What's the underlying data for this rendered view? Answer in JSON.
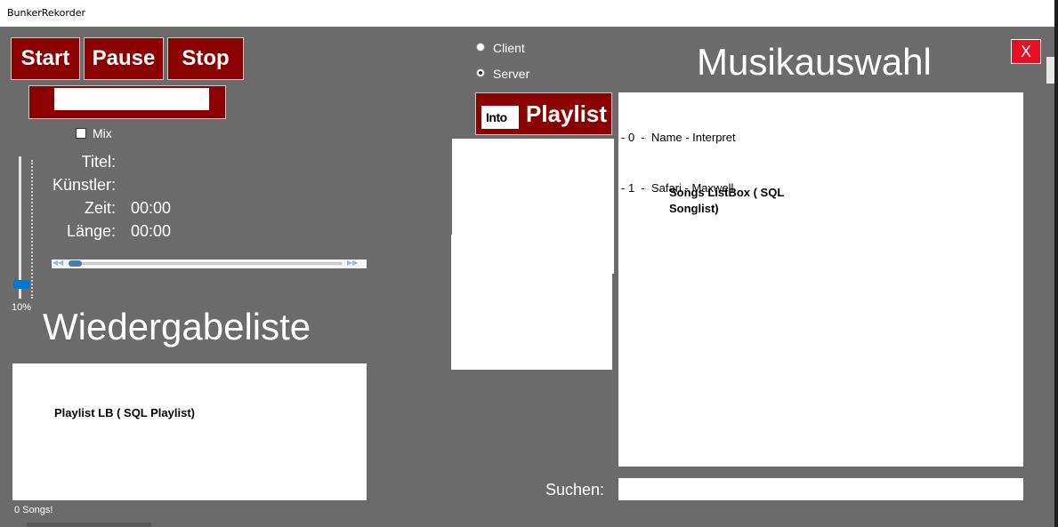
{
  "window": {
    "title": "BunkerRekorder"
  },
  "controls": {
    "start": "Start",
    "pause": "Pause",
    "stop": "Stop",
    "close": "X",
    "mix": "Mix"
  },
  "info": {
    "titel_label": "Titel:",
    "titel_value": "",
    "kuenstler_label": "Künstler:",
    "kuenstler_value": "",
    "zeit_label": "Zeit:",
    "zeit_value": "00:00",
    "laenge_label": "Länge:",
    "laenge_value": "00:00"
  },
  "volume": {
    "value_label": "10%",
    "fraction": 0.1
  },
  "seek": {
    "fraction": 0.0
  },
  "mode": {
    "client": "Client",
    "server": "Server",
    "selected": "server"
  },
  "playlist": {
    "heading": "Wiedergabeliste",
    "placeholder": "Playlist LB ( SQL Playlist)",
    "count": "0 Songs!"
  },
  "into_button": {
    "small": "Into",
    "large": "Playlist"
  },
  "music": {
    "heading": "Musikauswahl",
    "rows": [
      "- 0  -  Name - Interpret",
      "- 1  -  Safari - Maxwell"
    ],
    "placeholder": "Songs ListBox ( SQL Songlist)"
  },
  "search": {
    "label": "Suchen:",
    "value": ""
  },
  "colors": {
    "background": "#6b6b6b",
    "button": "#8b0000",
    "close": "#e81123",
    "slider_thumb": "#0078d7"
  }
}
